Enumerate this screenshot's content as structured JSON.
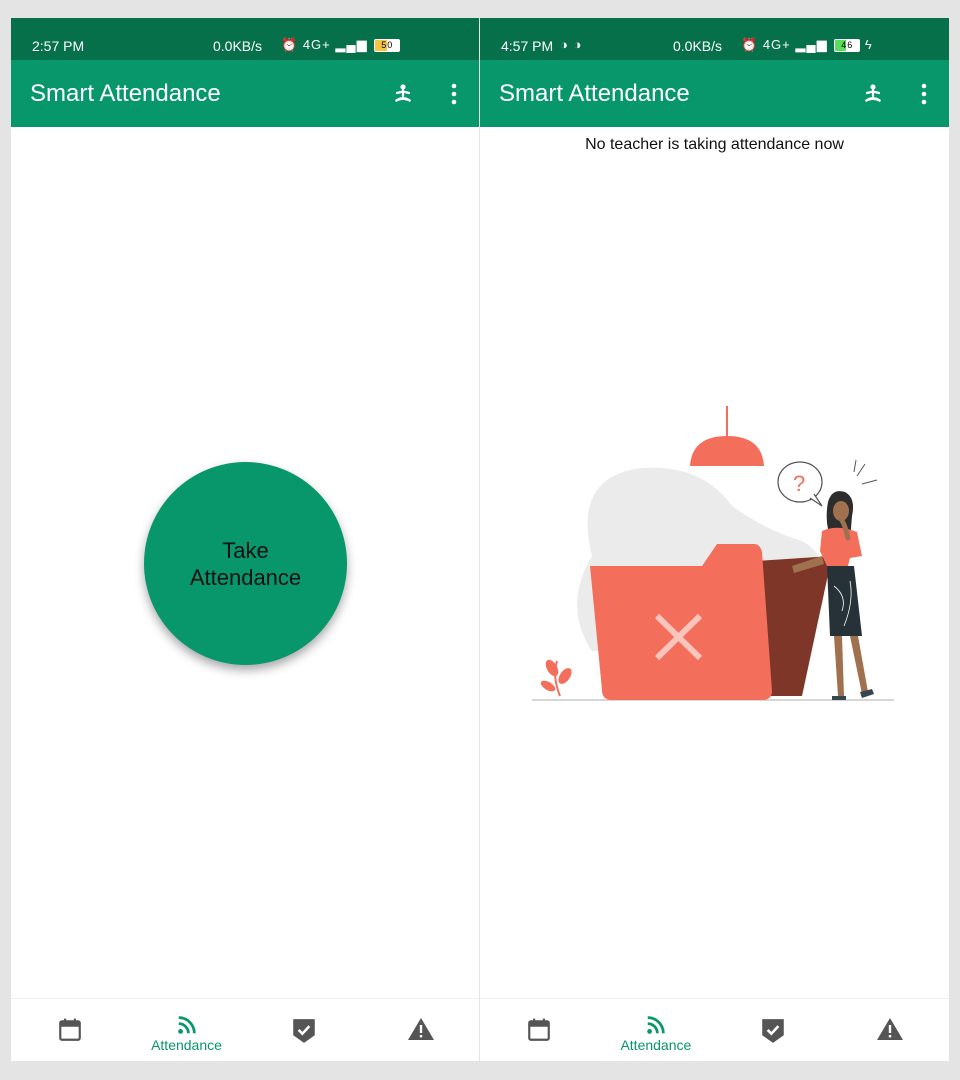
{
  "left_screen": {
    "status": {
      "time": "2:57 PM",
      "net_speed": "0.0KB/s",
      "signal": "4G+",
      "battery": "50"
    },
    "appbar": {
      "title": "Smart Attendance"
    },
    "main": {
      "take_button_label": "Take\nAttendance"
    },
    "nav": {
      "active_label": "Attendance"
    }
  },
  "right_screen": {
    "status": {
      "time": "4:57 PM",
      "net_speed": "0.0KB/s",
      "signal": "4G+",
      "battery": "46"
    },
    "appbar": {
      "title": "Smart Attendance"
    },
    "main": {
      "notice": "No teacher is taking attendance now",
      "illustration_mark": "?"
    },
    "nav": {
      "active_label": "Attendance"
    }
  },
  "colors": {
    "primary": "#08976a",
    "status_bar": "#05704a",
    "inactive_icon": "#555555"
  },
  "icons": [
    "meditation-icon",
    "more-vert-icon",
    "calendar-icon",
    "rss-feed-icon",
    "verified-check-icon",
    "warning-icon"
  ]
}
